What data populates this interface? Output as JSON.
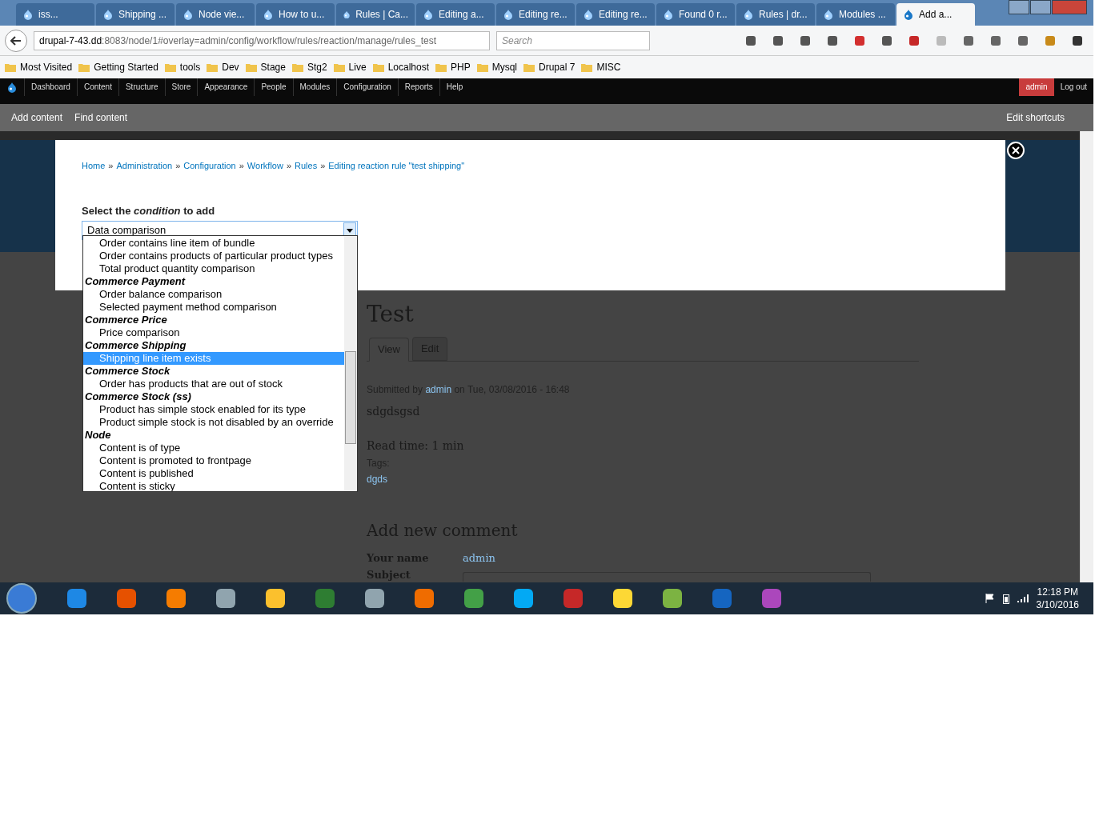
{
  "browser_tabs": [
    {
      "title": "iss...",
      "selected": false
    },
    {
      "title": "Shipping ...",
      "selected": false
    },
    {
      "title": "Node vie...",
      "selected": false
    },
    {
      "title": "How to u...",
      "selected": false
    },
    {
      "title": "Rules | Ca...",
      "selected": false
    },
    {
      "title": "Editing a...",
      "selected": false
    },
    {
      "title": "Editing re...",
      "selected": false
    },
    {
      "title": "Editing re...",
      "selected": false
    },
    {
      "title": "Found 0 r...",
      "selected": false
    },
    {
      "title": "Rules | dr...",
      "selected": false
    },
    {
      "title": "Modules ...",
      "selected": false
    },
    {
      "title": "Add a...",
      "selected": true
    }
  ],
  "address": {
    "host": "drupal-7-43.dd",
    "rest": ":8083/node/1#overlay=admin/config/workflow/rules/reaction/manage/rules_test"
  },
  "search": {
    "placeholder": "Search"
  },
  "bookmarks": [
    "Most Visited",
    "Getting Started",
    "tools",
    "Dev",
    "Stage",
    "Stg2",
    "Live",
    "Localhost",
    "PHP",
    "Mysql",
    "Drupal 7",
    "MISC"
  ],
  "admin_menu": [
    "Dashboard",
    "Content",
    "Structure",
    "Store",
    "Appearance",
    "People",
    "Modules",
    "Configuration",
    "Reports",
    "Help"
  ],
  "admin_user": "admin",
  "logout": "Log out",
  "shortcuts": [
    "Add content",
    "Find content"
  ],
  "edit_shortcuts": "Edit shortcuts",
  "breadcrumb_separator": "»",
  "breadcrumb": [
    "Home",
    "Administration",
    "Configuration",
    "Workflow",
    "Rules",
    "Editing reaction rule \"test shipping\""
  ],
  "select_label": "Select the *condition* to add",
  "select_value": "Data comparison",
  "options": [
    {
      "kind": "option",
      "label": "Order contains line item of bundle",
      "selected": false
    },
    {
      "kind": "option",
      "label": "Order contains products of particular product types",
      "selected": false
    },
    {
      "kind": "option",
      "label": "Total product quantity comparison",
      "selected": false
    },
    {
      "kind": "group",
      "label": "Commerce Payment"
    },
    {
      "kind": "option",
      "label": "Order balance comparison",
      "selected": false
    },
    {
      "kind": "option",
      "label": "Selected payment method comparison",
      "selected": false
    },
    {
      "kind": "group",
      "label": "Commerce Price"
    },
    {
      "kind": "option",
      "label": "Price comparison",
      "selected": false
    },
    {
      "kind": "group",
      "label": "Commerce Shipping"
    },
    {
      "kind": "option",
      "label": "Shipping line item exists",
      "selected": true
    },
    {
      "kind": "group",
      "label": "Commerce Stock"
    },
    {
      "kind": "option",
      "label": "Order has products that are out of stock",
      "selected": false
    },
    {
      "kind": "group",
      "label": "Commerce Stock (ss)"
    },
    {
      "kind": "option",
      "label": "Product has simple stock enabled for its type",
      "selected": false
    },
    {
      "kind": "option",
      "label": "Product simple stock is not disabled by an override",
      "selected": false
    },
    {
      "kind": "group",
      "label": "Node"
    },
    {
      "kind": "option",
      "label": "Content is of type",
      "selected": false
    },
    {
      "kind": "option",
      "label": "Content is promoted to frontpage",
      "selected": false
    },
    {
      "kind": "option",
      "label": "Content is published",
      "selected": false
    },
    {
      "kind": "option",
      "label": "Content is sticky",
      "selected": false
    }
  ],
  "node": {
    "title": "Test",
    "tabs": [
      {
        "label": "View",
        "selected": true
      },
      {
        "label": "Edit",
        "selected": false
      }
    ],
    "submitted": {
      "prefix": "Submitted by",
      "author": "admin",
      "suffix": "on Tue, 03/08/2016 - 16:48"
    },
    "body": "sdgdsgsd",
    "read_time": "Read time: 1 min",
    "tags_label": "Tags:",
    "tag": "dgds",
    "comment_heading": "Add new comment",
    "name_label": "Your name",
    "name_value": "admin",
    "subject_label": "Subject"
  },
  "clock": {
    "time": "12:18 PM",
    "date": "3/10/2016"
  }
}
